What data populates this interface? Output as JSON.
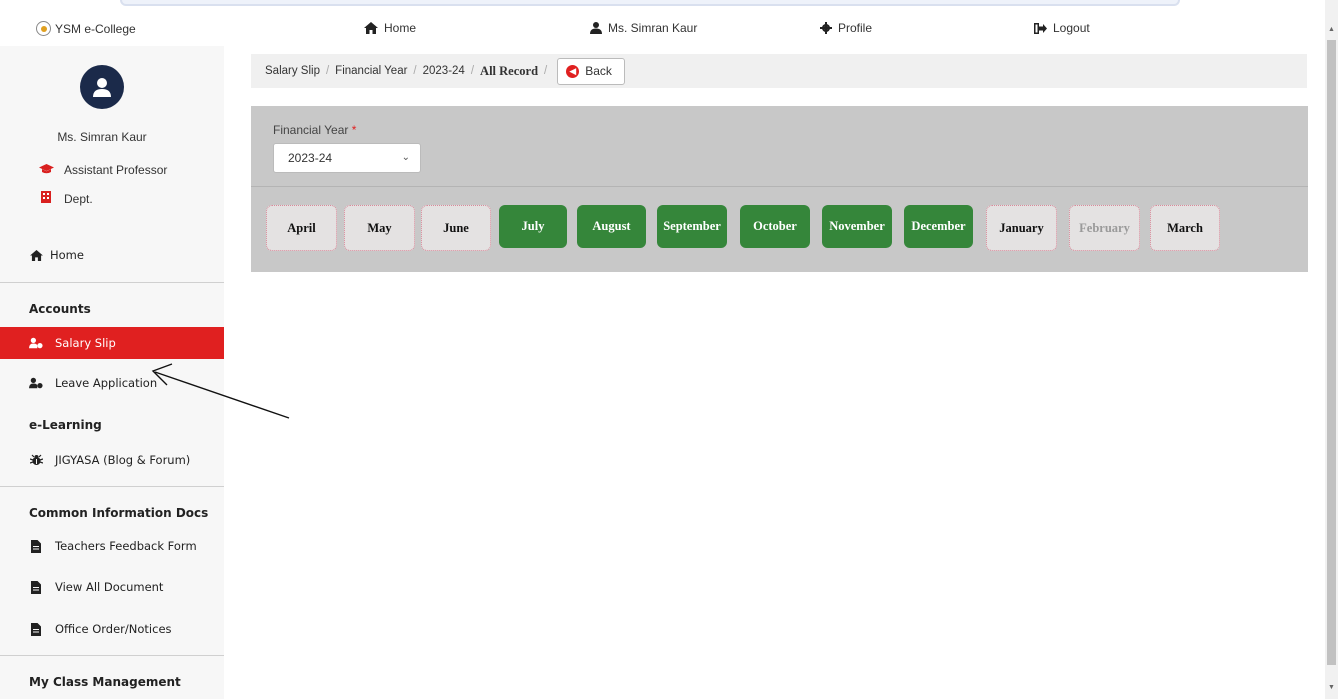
{
  "topnav": {
    "brand": "YSM e-College",
    "home": "Home",
    "user": "Ms. Simran Kaur",
    "profile": "Profile",
    "logout": "Logout"
  },
  "sidebar": {
    "user_name": "Ms. Simran Kaur",
    "designation": "Assistant Professor",
    "dept": "Dept.",
    "home": "Home",
    "sections": {
      "accounts": "Accounts",
      "elearning": "e-Learning",
      "common_docs": "Common Information Docs",
      "class_mgmt": "My Class Management"
    },
    "items": {
      "salary_slip": "Salary Slip",
      "leave_application": "Leave Application",
      "jigyasa": "JIGYASA (Blog & Forum)",
      "teachers_feedback": "Teachers Feedback Form",
      "view_all_docs": "View All Document",
      "office_order": "Office Order/Notices"
    }
  },
  "breadcrumb": {
    "salary_slip": "Salary Slip",
    "financial_year": "Financial Year",
    "year": "2023-24",
    "all_record": "All Record",
    "back": "Back"
  },
  "filter": {
    "label": "Financial Year",
    "required_mark": "*",
    "selected": "2023-24"
  },
  "months": [
    {
      "label": "April",
      "status": "pending"
    },
    {
      "label": "May",
      "status": "pending"
    },
    {
      "label": "June",
      "status": "pending"
    },
    {
      "label": "July",
      "status": "paid"
    },
    {
      "label": "August",
      "status": "paid"
    },
    {
      "label": "September",
      "status": "paid"
    },
    {
      "label": "October",
      "status": "paid"
    },
    {
      "label": "November",
      "status": "paid"
    },
    {
      "label": "December",
      "status": "paid"
    },
    {
      "label": "January",
      "status": "pending"
    },
    {
      "label": "February",
      "status": "disabled"
    },
    {
      "label": "March",
      "status": "pending"
    }
  ],
  "colors": {
    "accent_red": "#e02020",
    "paid_green": "#35863a",
    "card_gray": "#c8c8c8"
  }
}
